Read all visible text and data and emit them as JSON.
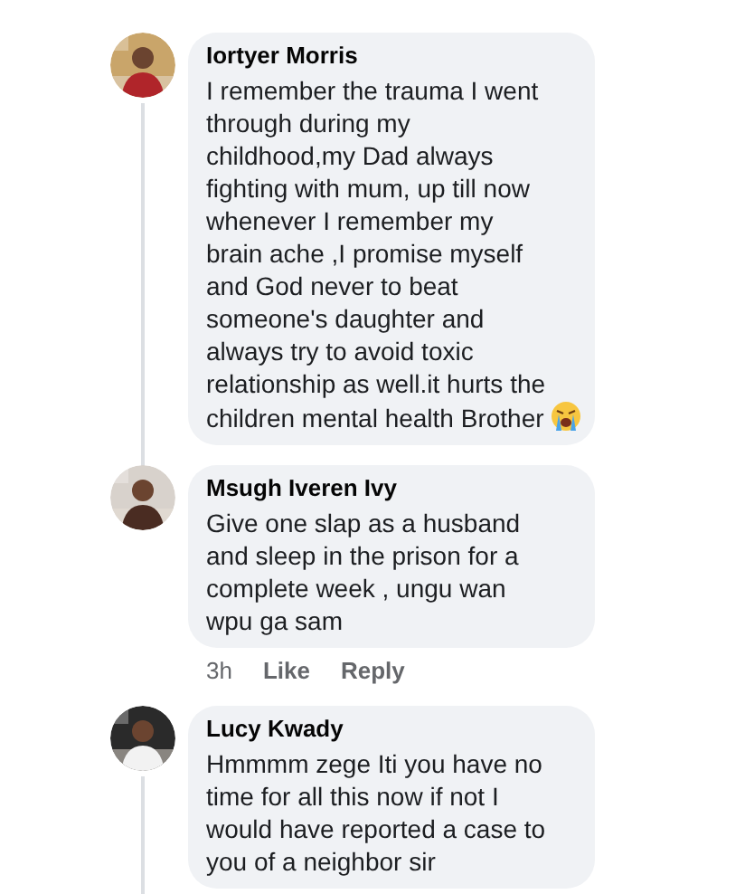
{
  "comments": [
    {
      "author": "Iortyer Morris",
      "text": "I remember the trauma I went through during my childhood,my Dad always fighting with mum, up till now whenever I remember my brain ache ,I promise myself and God never to beat someone's daughter and always try to avoid toxic relationship as well.it hurts the children mental health Brother",
      "crying_emoji": true,
      "thread_line": true
    },
    {
      "author": "Msugh Iveren Ivy",
      "text": "Give one slap as a husband and sleep in the prison for a complete week , ungu wan wpu ga sam",
      "thread_line": false,
      "time": "3h",
      "actions": [
        "Like",
        "Reply"
      ]
    },
    {
      "author": "Lucy Kwady",
      "text": "Hmmmm zege Iti you have no time for all this now if not I would have reported a case to you of a neighbor sir",
      "thread_line": true
    }
  ]
}
